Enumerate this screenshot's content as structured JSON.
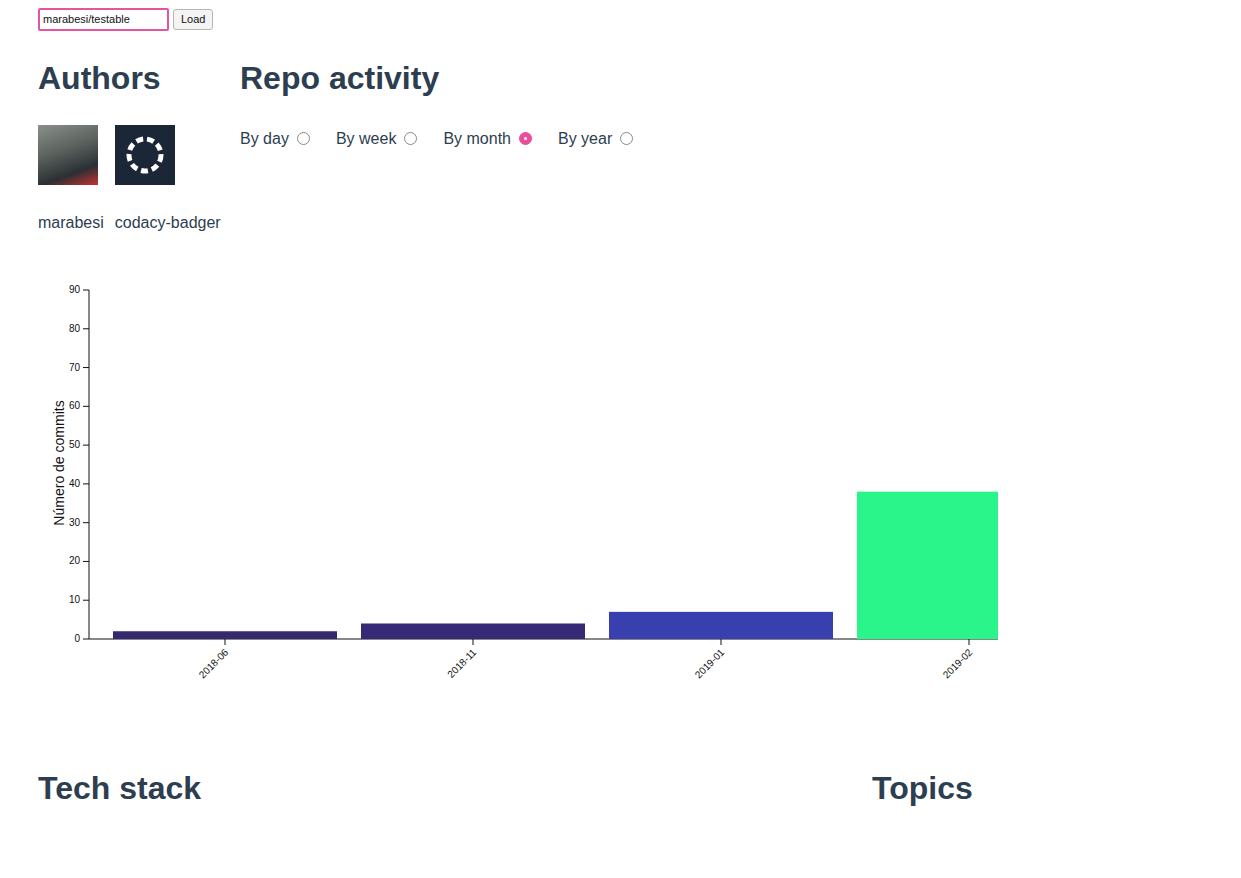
{
  "repo_input": {
    "value": "marabesi/testable"
  },
  "load_button": "Load",
  "authors": {
    "title": "Authors",
    "items": [
      {
        "name": "marabesi",
        "kind": "photo"
      },
      {
        "name": "codacy-badger",
        "kind": "logo"
      }
    ]
  },
  "activity": {
    "title": "Repo activity",
    "periods": [
      {
        "label": "By day",
        "selected": false
      },
      {
        "label": "By week",
        "selected": false
      },
      {
        "label": "By month",
        "selected": true
      },
      {
        "label": "By year",
        "selected": false
      }
    ],
    "chart": {
      "y_label": "Número de commits",
      "y_ticks": [
        "0",
        "10",
        "20",
        "30",
        "40",
        "50",
        "60",
        "70",
        "80",
        "90"
      ],
      "bars": [
        {
          "label": "2018-06",
          "value": 2,
          "color": "#35286f"
        },
        {
          "label": "2018-11",
          "value": 4,
          "color": "#362a77"
        },
        {
          "label": "2019-01",
          "value": 7,
          "color": "#383faf"
        },
        {
          "label": "2019-02",
          "value": 38,
          "color": "#29f58b"
        }
      ]
    }
  },
  "tech_stack": {
    "title": "Tech stack"
  },
  "topics": {
    "title": "Topics"
  }
}
